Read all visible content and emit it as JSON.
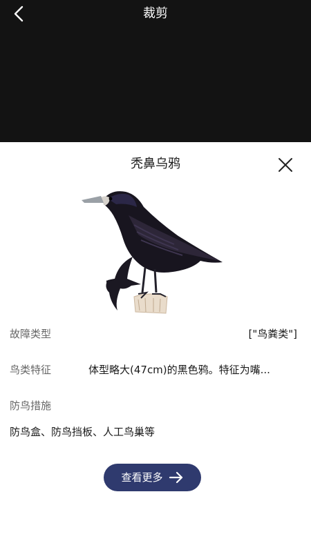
{
  "header": {
    "title": "裁剪",
    "back_icon": "chevron-left-icon"
  },
  "card": {
    "bird_name": "秃鼻乌鸦",
    "close_icon": "close-icon",
    "image": "rook-bird-illustration",
    "fields": [
      {
        "label": "故障类型",
        "value": "[\"鸟粪类\"]"
      },
      {
        "label": "鸟类特征",
        "value": "体型略大(47cm)的黑色鸦。特征为嘴..."
      },
      {
        "label": "防鸟措施",
        "value": "防鸟盒、防鸟挡板、人工鸟巢等"
      }
    ],
    "more_button": {
      "label": "查看更多",
      "icon": "arrow-right-icon"
    }
  },
  "colors": {
    "topbar": "#131313",
    "button": "#2f3a6e",
    "label": "#666666"
  }
}
